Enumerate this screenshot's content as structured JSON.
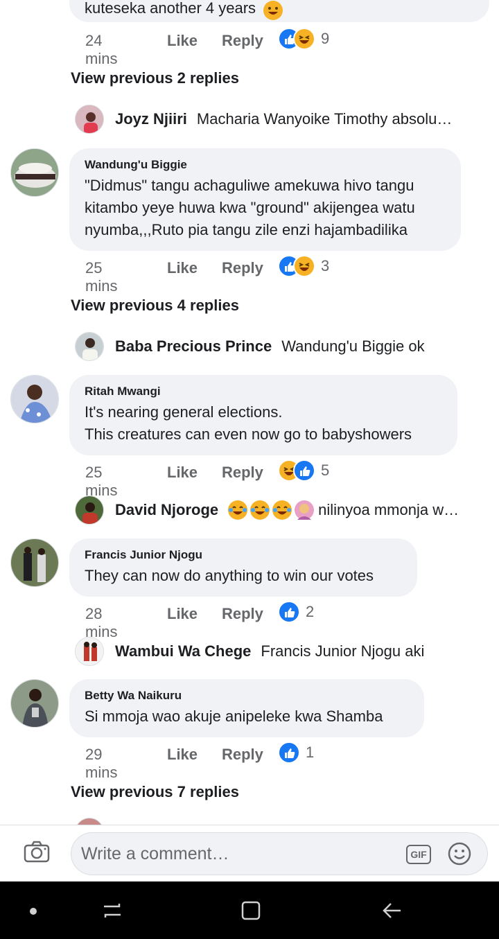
{
  "comments": [
    {
      "partial_text": "kuteseka another 4 years",
      "time": "24 mins",
      "like": "Like",
      "reply": "Reply",
      "reaction_count": "9"
    },
    {
      "author": "Wandung'u Biggie",
      "lines": [
        "\"Didmus\" tangu achaguliwe amekuwa hivo tangu",
        "kitambo yeye huwa kwa \"ground\" akijengea watu",
        "nyumba,,,Ruto pia tangu zile enzi hajambadilika"
      ],
      "time": "25 mins",
      "like": "Like",
      "reply": "Reply",
      "reaction_count": "3"
    },
    {
      "author": "Ritah Mwangi",
      "lines": [
        "It's nearing general elections.",
        "This creatures can even now go to babyshowers"
      ],
      "time": "25 mins",
      "like": "Like",
      "reply": "Reply",
      "reaction_count": "5"
    },
    {
      "author": "Francis Junior Njogu",
      "lines": [
        "They can now do anything to win our votes"
      ],
      "time": "28 mins",
      "like": "Like",
      "reply": "Reply",
      "reaction_count": "2"
    },
    {
      "author": "Betty Wa Naikuru",
      "lines": [
        "Si mmoja wao akuje anipeleke kwa Shamba"
      ],
      "time": "29 mins",
      "like": "Like",
      "reply": "Reply",
      "reaction_count": "1"
    }
  ],
  "view_previous": [
    "View previous 2 replies",
    "View previous 4 replies",
    "View previous 7 replies"
  ],
  "replies": [
    {
      "name": "Joyz Njiiri",
      "text": "Macharia Wanyoike Timothy absolu…"
    },
    {
      "name": "Baba Precious Prince",
      "text": "Wandung'u Biggie ok"
    },
    {
      "name": "David Njoroge",
      "text": "nilinyoa mmonja w…"
    },
    {
      "name": "Wambui Wa Chege",
      "text": "Francis Junior Njogu aki"
    }
  ],
  "composer": {
    "placeholder": "Write a comment…",
    "gif_label": "GIF",
    "camera_icon": "camera-icon",
    "emoji_icon": "emoji-icon"
  },
  "colors": {
    "like_blue": "#1877f2",
    "haha_yellow": "#f7b125",
    "bubble_bg": "#f0f2f5",
    "meta_gray": "#65676b"
  }
}
